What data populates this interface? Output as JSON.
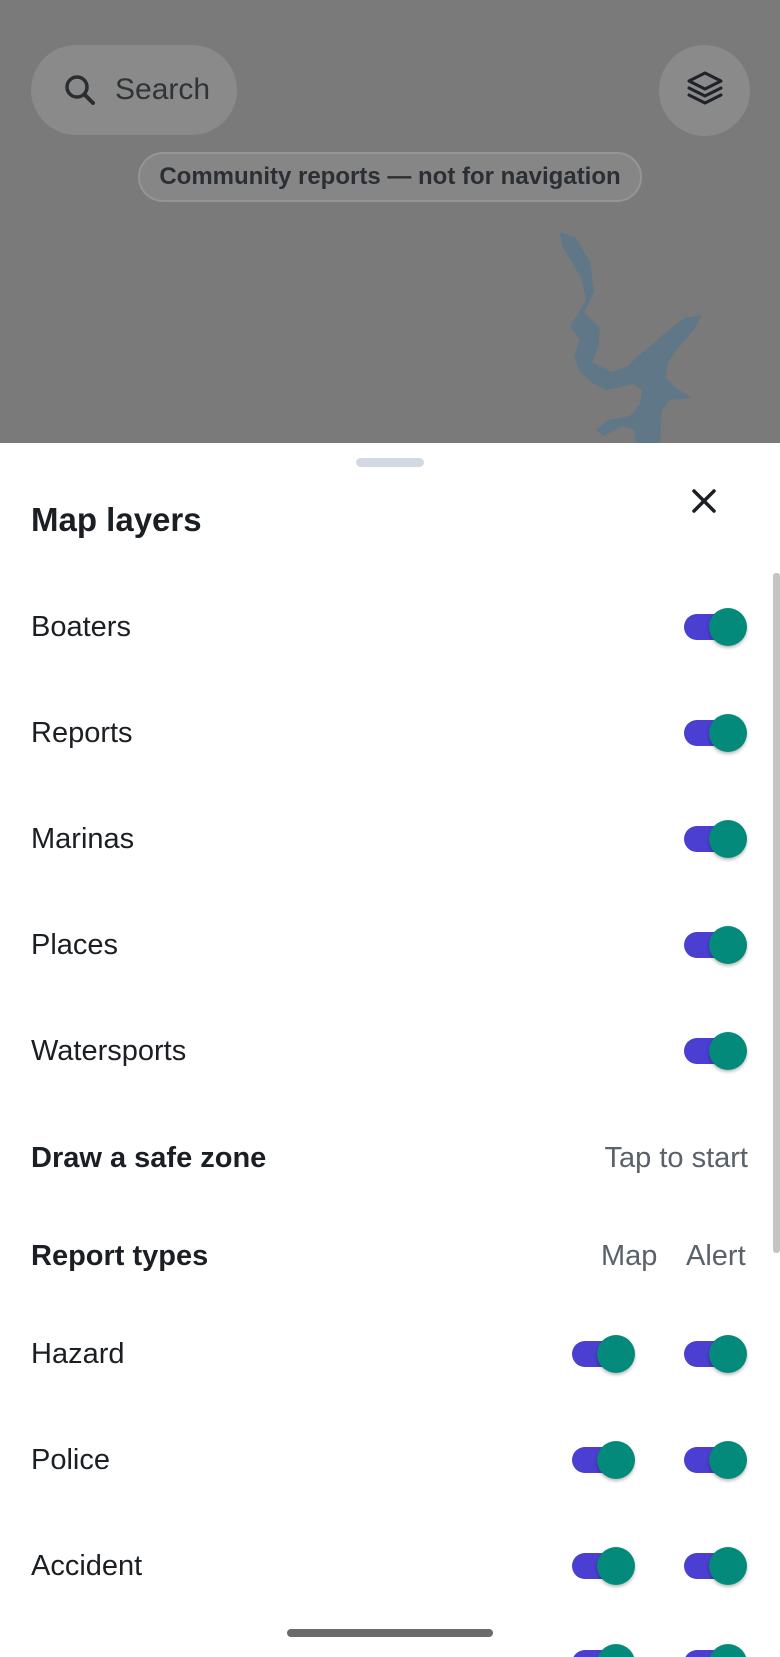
{
  "map": {
    "search_label": "Search",
    "disclaimer": "Community reports — not for navigation"
  },
  "sheet": {
    "title": "Map layers",
    "layers": [
      {
        "label": "Boaters",
        "on": true
      },
      {
        "label": "Reports",
        "on": true
      },
      {
        "label": "Marinas",
        "on": true
      },
      {
        "label": "Places",
        "on": true
      },
      {
        "label": "Watersports",
        "on": true
      }
    ],
    "safe_zone": {
      "label": "Draw a safe zone",
      "action": "Tap to start"
    },
    "report_types": {
      "label": "Report types",
      "col_map": "Map",
      "col_alert": "Alert",
      "items": [
        {
          "label": "Hazard",
          "map": true,
          "alert": true
        },
        {
          "label": "Police",
          "map": true,
          "alert": true
        },
        {
          "label": "Accident",
          "map": true,
          "alert": true
        }
      ]
    }
  },
  "colors": {
    "toggle_track": "#4a3fd0",
    "toggle_thumb": "#048a7a",
    "map_scrim": "#7a7a7a"
  },
  "icons": {
    "search": "search-icon",
    "layers": "layers-icon",
    "close": "close-icon"
  }
}
